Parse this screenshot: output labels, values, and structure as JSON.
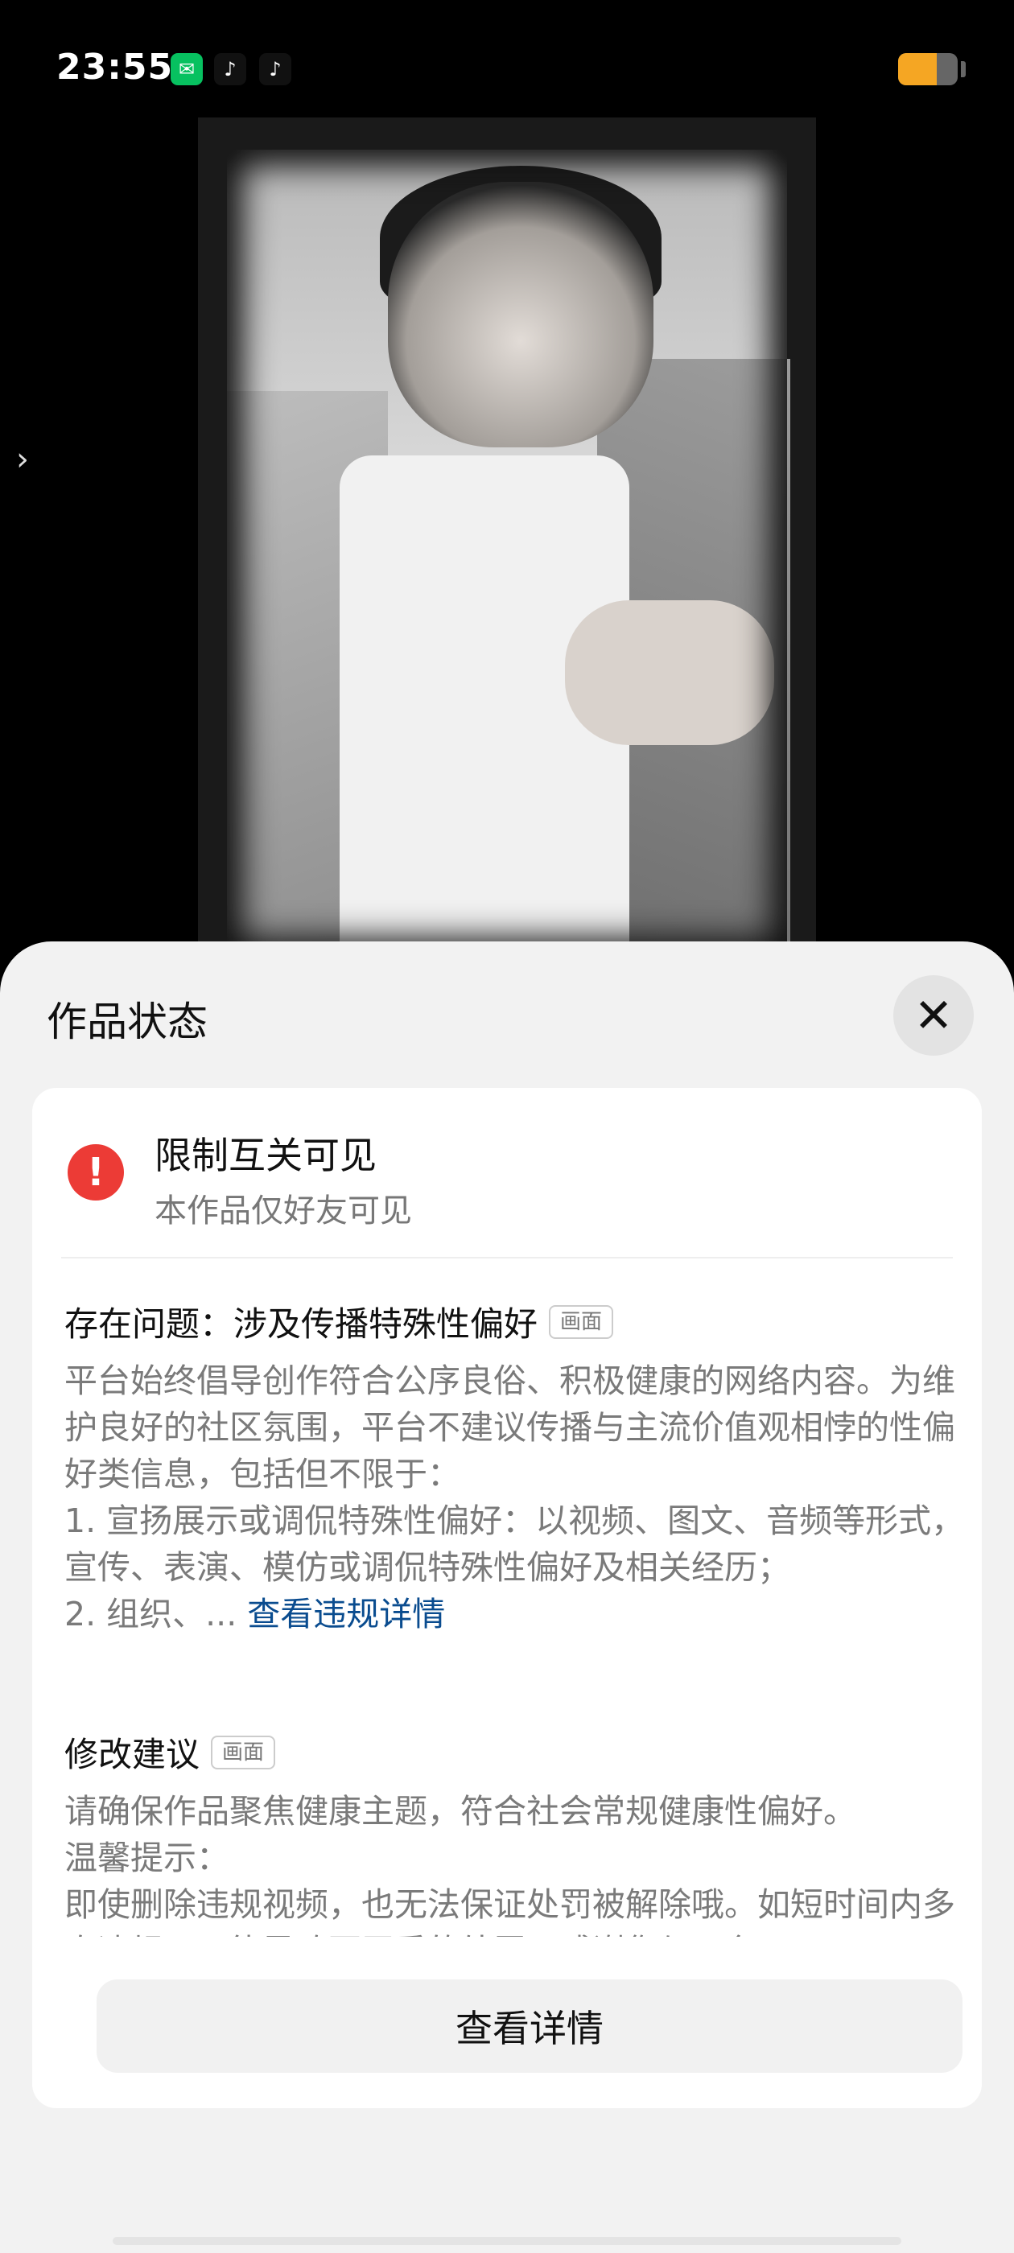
{
  "status_bar": {
    "time": "23:55",
    "icons": [
      "wechat-icon",
      "tiktok-icon",
      "tiktok-lite-icon"
    ],
    "battery_level": 0.65,
    "colors": {
      "battery": "#f5a623",
      "wechat": "#07c160"
    }
  },
  "video_nav": {
    "left_arrow_icon": "chevron-right-icon"
  },
  "sheet": {
    "title": "作品状态",
    "close_icon": "close-icon",
    "status": {
      "icon": "exclamation-icon",
      "title": "限制互关可见",
      "subtitle": "本作品仅好友可见"
    },
    "issue": {
      "title": "存在问题：涉及传播特殊性偏好",
      "tag": "画面",
      "body": "平台始终倡导创作符合公序良俗、积极健康的网络内容。为维护良好的社区氛围，平台不建议传播与主流价值观相悖的性偏好类信息，包括但不限于：\n1. 宣扬展示或调侃特殊性偏好：以视频、图文、音频等形式，宣传、表演、模仿或调侃特殊性偏好及相关经历；\n2. 组织、... ",
      "link": "查看违规详情"
    },
    "suggestion": {
      "title": "修改建议",
      "tag": "画面",
      "body": "请确保作品聚焦健康主题，符合社会常规健康性偏好。\n温馨提示：\n即使删除违规视频，也无法保证处罚被解除哦。如短时间内多次违规，可能导致更严重的处罚，感谢您与平台"
    },
    "details_button": "查看详情"
  },
  "colors": {
    "warn_red": "#ec3b36",
    "link_blue": "#0a4c8f",
    "sheet_bg": "#f2f2f2"
  }
}
